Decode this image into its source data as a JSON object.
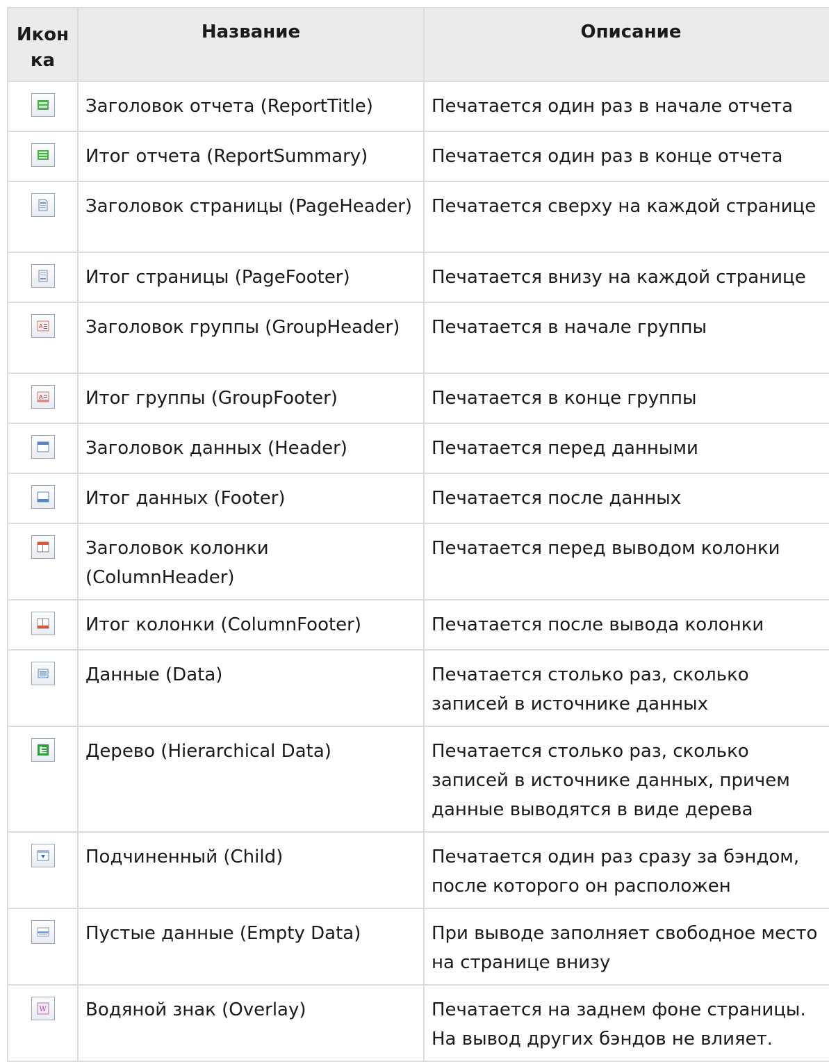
{
  "table": {
    "headers": {
      "icon": "Икон ка",
      "name": "Название",
      "desc": "Описание"
    },
    "rows": [
      {
        "icon": "report-title-band-icon",
        "name": "Заголовок отчета (ReportTitle)",
        "desc": "Печатается один раз в начале отчета"
      },
      {
        "icon": "report-summary-band-icon",
        "name": "Итог отчета (ReportSummary)",
        "desc": "Печатается один раз в конце отчета"
      },
      {
        "icon": "page-header-band-icon",
        "name": "Заголовок страницы (PageHeader)",
        "desc": "Печатается сверху на каждой странице"
      },
      {
        "icon": "page-footer-band-icon",
        "name": "Итог страницы (PageFooter)",
        "desc": "Печатается внизу на каждой странице"
      },
      {
        "icon": "group-header-band-icon",
        "name": "Заголовок группы (GroupHeader)",
        "desc": "Печатается в начале группы"
      },
      {
        "icon": "group-footer-band-icon",
        "name": "Итог группы (GroupFooter)",
        "desc": "Печатается в конце группы"
      },
      {
        "icon": "header-band-icon",
        "name": "Заголовок данных (Header)",
        "desc": "Печатается перед данными"
      },
      {
        "icon": "footer-band-icon",
        "name": "Итог данных (Footer)",
        "desc": "Печатается после данных"
      },
      {
        "icon": "column-header-band-icon",
        "name": "Заголовок колонки (ColumnHeader)",
        "desc": "Печатается перед выводом колонки"
      },
      {
        "icon": "column-footer-band-icon",
        "name": "Итог колонки (ColumnFooter)",
        "desc": "Печатается после вывода колонки"
      },
      {
        "icon": "data-band-icon",
        "name": "Данные (Data)",
        "desc": "Печатается столько раз, сколько записей в источнике данных"
      },
      {
        "icon": "hierarchical-band-icon",
        "name": "Дерево (Hierarchical Data)",
        "desc": "Печатается столько раз, сколько записей в источнике данных, причем данные выводятся в виде дерева"
      },
      {
        "icon": "child-band-icon",
        "name": "Подчиненный (Child)",
        "desc": "Печатается один раз сразу за бэндом, после которого он расположен"
      },
      {
        "icon": "empty-data-band-icon",
        "name": "Пустые данные (Empty Data)",
        "desc": "При выводе заполняет свободное место на странице внизу"
      },
      {
        "icon": "overlay-band-icon",
        "name": "Водяной знак (Overlay)",
        "desc": "Печатается на заднем фоне страницы. На вывод других бэндов не влияет."
      }
    ]
  }
}
